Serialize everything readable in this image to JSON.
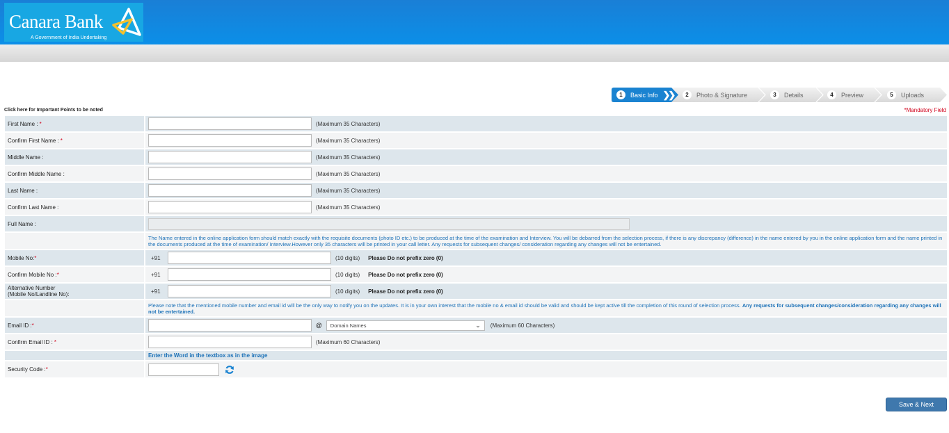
{
  "header": {
    "logo_name": "Canara Bank",
    "logo_tagline": "A Government of India Undertaking",
    "colors": {
      "brand_blue": "#0b8fe8",
      "logo_bg": "#18a7e3",
      "logo_mark_yellow": "#f2c12e"
    }
  },
  "wizard": {
    "steps": [
      {
        "num": "1",
        "label": "Basic Info",
        "active": true
      },
      {
        "num": "2",
        "label": "Photo & Signature",
        "active": false
      },
      {
        "num": "3",
        "label": "Details",
        "active": false
      },
      {
        "num": "4",
        "label": "Preview",
        "active": false
      },
      {
        "num": "5",
        "label": "Uploads",
        "active": false
      }
    ],
    "active_color": "#1a83d1"
  },
  "important_link": "Click here for Important Points to be noted",
  "mandatory_note": "*Mandatory Field",
  "form": {
    "star": "*",
    "max35": "(Maximum 35 Characters)",
    "max60": "(Maximum 60 Characters)",
    "fields": {
      "first_name": {
        "label": "First Name :",
        "value": ""
      },
      "confirm_first_name": {
        "label": "Confirm First Name :",
        "value": ""
      },
      "middle_name": {
        "label": "Middle Name :",
        "value": ""
      },
      "confirm_middle_name": {
        "label": "Confirm Middle Name :",
        "value": ""
      },
      "last_name": {
        "label": "Last Name :",
        "value": ""
      },
      "confirm_last_name": {
        "label": "Confirm Last Name :",
        "value": ""
      },
      "full_name": {
        "label": "Full Name :",
        "value": ""
      }
    },
    "name_note": "The Name entered in the online application form should match exactly with the requisite documents (photo ID etc.) to be produced at the time of the examination and Interview. You will be debarred from the selection process, if there is any discrepancy (difference) in the name entered by you in the online application form and the name printed in the documents produced at the time of examination/ Interview.However only 35 characters will be printed in your call letter. Any requests for subsequent changes/ consideration regarding any changes will not be entertained.",
    "mobile": {
      "country_code": "+91",
      "digits_hint": "(10 digits)",
      "zero_hint": "Please Do not prefix zero (0)",
      "mobile_label": "Mobile No:",
      "confirm_mobile_label": "Confirm Mobile No :",
      "alt_label_1": "Alternative Number",
      "alt_label_2": "(Mobile No/Landline No):"
    },
    "contact_note_normal": "Please note that the mentioned mobile number and email id will be the only way to notify you on the updates. It is in your own interest that the mobile no & email id should be valid and should be kept active till the completion of this round of selection process. ",
    "contact_note_bold": "Any requests for subsequent changes/consideration regarding any changes will not be entertained.",
    "email": {
      "label": "Email ID :",
      "at": "@",
      "domain_selected": "Domain Names",
      "confirm_label": "Confirm Email ID :"
    },
    "captcha_note": "Enter the Word in the textbox as in the image",
    "security_label": "Security Code :"
  },
  "save_button": "Save & Next"
}
